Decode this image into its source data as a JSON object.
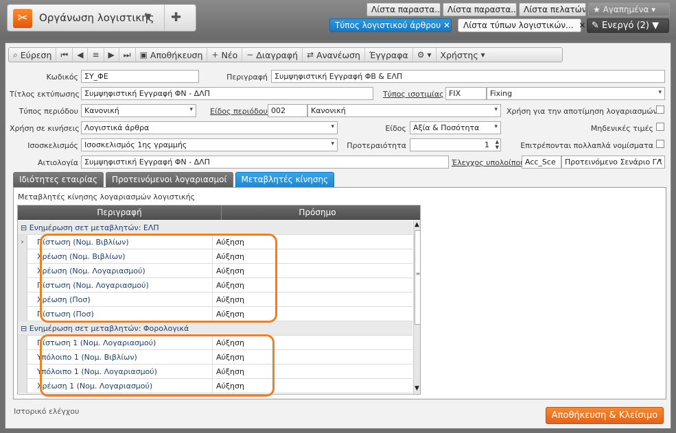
{
  "module": {
    "title": "Οργάνωση λογιστικής",
    "icon": "tools-icon",
    "puzzle_icon": "puzzle-icon"
  },
  "pinned_tabs": [
    "Λίστα παραστα...",
    "Λίστα παραστα...",
    "Λίστα πελατών",
    "★ Αγαπημένα ▾"
  ],
  "window_tabs": {
    "active": "Τύπος λογιστικού άρθρου",
    "other": "Λίστα τύπων λογιστικών...",
    "energo": "Ενεργό (2)"
  },
  "toolbar": {
    "search": "Εύρεση",
    "save": "Αποθήκευση",
    "new": "Νέο",
    "delete": "Διαγραφή",
    "refresh": "Ανανέωση",
    "documents": "Έγγραφα",
    "users": "Χρήστης"
  },
  "form": {
    "code_label": "Κωδικός",
    "code_value": "ΣΥ_ΦΕ",
    "desc_label": "Περιγραφή",
    "desc_value": "Συμψηφιστική Εγγραφή ΦΒ & ΕΛΠ",
    "print_title_label": "Τίτλος εκτύπωσης",
    "print_title_value": "Συμψηφιστική Εγγραφή ΦΝ - ΔΛΠ",
    "rate_type_label": "Τύπος ισοτιμίας",
    "rate_type_code": "FIX",
    "rate_type_value": "Fixing",
    "period_type_label": "Τύπος περιόδου",
    "period_type_value": "Κανονική",
    "period_kind_label": "Είδος περιόδου",
    "period_kind_code": "002",
    "period_kind_value": "Κανονική",
    "valuation_label": "Χρήση για την αποτίμηση λογαριασμών",
    "usage_label": "Χρήση σε κινήσεις",
    "usage_value": "Λογιστικά άρθρα",
    "kind_label": "Είδος",
    "kind_value": "Αξία & Ποσότητα",
    "zero_label": "Μηδενικές τιμές",
    "balancing_label": "Ισοσκελισμός",
    "balancing_value": "Ισοσκελισμός 1ης γραμμής",
    "priority_label": "Προτεραιότητα",
    "priority_value": "1",
    "multicurrency_label": "Επιτρέπονται πολλαπλά νομίσματα",
    "reason_label": "Αιτιολογία",
    "reason_value": "Συμψηφιστική Εγγραφή ΦΝ - ΔΛΠ",
    "balance_check_label": "Έλεγχος υπολοίπου",
    "balance_check_code": "Acc_Sce",
    "balance_check_value": "Προτεινόμενο Σενάριο ΓΛ"
  },
  "tabs": [
    "Ιδιότητες εταιρίας",
    "Προτεινόμενοι λογαριασμοί",
    "Μεταβλητές κίνησης"
  ],
  "panel_title": "Μεταβλητές κίνησης λογαριασμών λογιστικής",
  "grid": {
    "headers": [
      "Περιγραφή",
      "Πρόσημο"
    ],
    "groups": [
      {
        "title": "⊟ Ενημέρωση σετ μεταβλητών: ΕΛΠ",
        "rows": [
          [
            "Πίστωση (Νομ. Βιβλίων)",
            "Αύξηση"
          ],
          [
            "Χρέωση  (Νομ. Βιβλίων)",
            "Αύξηση"
          ],
          [
            "Χρέωση  (Νομ. Λογαριασμού)",
            "Αύξηση"
          ],
          [
            "Πίστωση  (Νομ. Λογαριασμού)",
            "Αύξηση"
          ],
          [
            "Χρέωση (Ποσ)",
            "Αύξηση"
          ],
          [
            "Πίστωση (Ποσ)",
            "Αύξηση"
          ]
        ]
      },
      {
        "title": "⊟ Ενημέρωση σετ μεταβλητών: Φορολογικά",
        "rows": [
          [
            "Πίστωση 1  (Νομ. Λογαριασμού)",
            "Αύξηση"
          ],
          [
            "Υπόλοιπο 1  (Νομ. Βιβλίων)",
            "Αύξηση"
          ],
          [
            "Υπόλοιπο 1  (Νομ. Λογαριασμού)",
            "Αύξηση"
          ],
          [
            "Χρέωση 1  (Νομ. Λογαριασμού)",
            "Αύξηση"
          ]
        ]
      }
    ]
  },
  "footer": {
    "audit": "Ιστορικό ελέγχου",
    "save_close": "Αποθήκευση & Κλείσιμο"
  },
  "colors": {
    "accent": "#1f86cf",
    "highlight": "#f07f24",
    "save_button": "#e3631a"
  }
}
